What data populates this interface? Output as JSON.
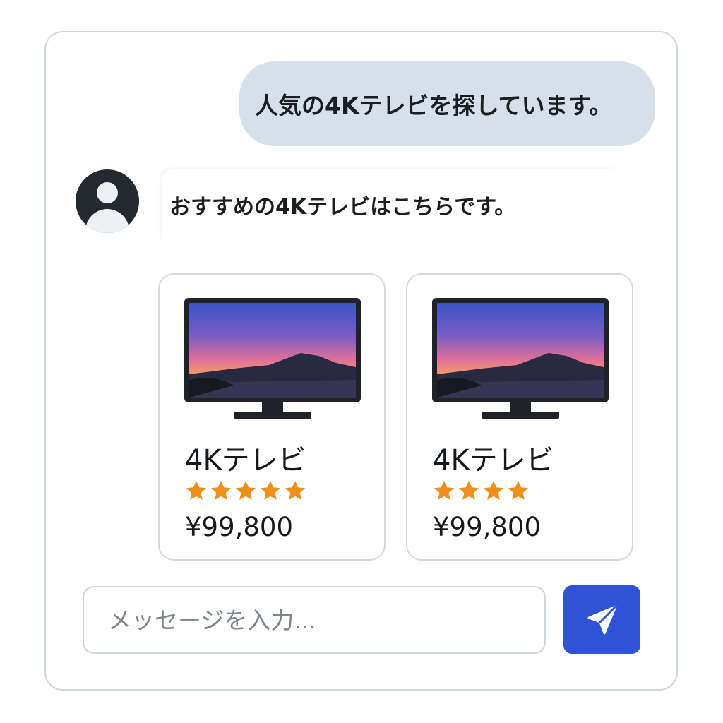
{
  "chat": {
    "user_message": "人気の4Kテレビを探しています。",
    "bot_message": "おすすめの4Kテレビはこちらです。"
  },
  "products": [
    {
      "name": "4Kテレビ",
      "rating": 5,
      "price": "¥99,800",
      "image_icon": "tv-icon"
    },
    {
      "name": "4Kテレビ",
      "rating": 4,
      "price": "¥99,800",
      "image_icon": "tv-icon"
    }
  ],
  "composer": {
    "placeholder": "メッセージを入力...",
    "value": "",
    "send_icon": "send-icon"
  },
  "colors": {
    "user_bubble": "#d7e0ea",
    "send_button": "#2f52d6",
    "star": "#ee8e1c",
    "avatar": "#23292f"
  }
}
